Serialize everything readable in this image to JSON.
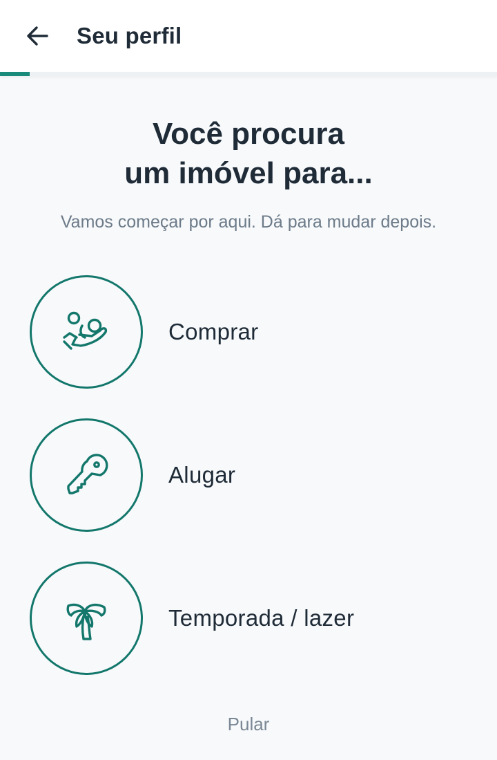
{
  "header": {
    "title": "Seu perfil",
    "back_icon": "arrow-left-icon",
    "progress_fraction": 0.06
  },
  "main": {
    "headline_line1": "Você procura",
    "headline_line2": "um imóvel para...",
    "subtitle": "Vamos começar por aqui. Dá para mudar depois.",
    "options": [
      {
        "label": "Comprar",
        "icon": "hand-holding-coins-icon"
      },
      {
        "label": "Alugar",
        "icon": "key-icon"
      },
      {
        "label": "Temporada / lazer",
        "icon": "palm-tree-icon"
      }
    ],
    "skip_label": "Pular"
  },
  "colors": {
    "accent": "#13776b",
    "progress": "#1a8a7a",
    "text": "#1f2b37",
    "muted": "#6d7b89",
    "background": "#f7f9fb"
  }
}
